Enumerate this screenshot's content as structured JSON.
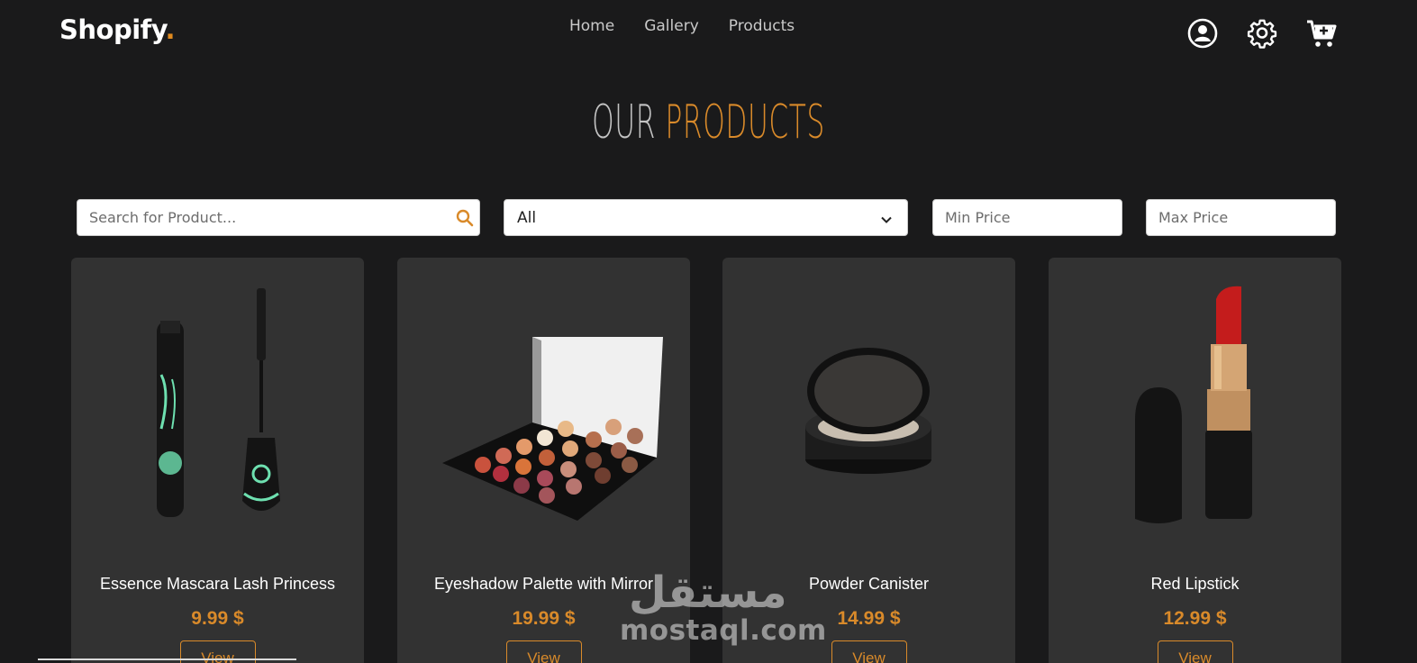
{
  "navbar": {
    "brand": "Shopify",
    "brand_dot": ".",
    "links": [
      "Home",
      "Gallery",
      "Products"
    ],
    "icons": [
      "user-icon",
      "gear-icon",
      "cart-plus-icon"
    ]
  },
  "heading": {
    "part1": "OUR",
    "part2": "PRODUCTS"
  },
  "filters": {
    "search_placeholder": "Search for Product...",
    "category_value": "All",
    "min_price_placeholder": "Min Price",
    "max_price_placeholder": "Max Price"
  },
  "products": [
    {
      "name": "Essence Mascara Lash Princess",
      "price": "9.99 $",
      "button": "View"
    },
    {
      "name": "Eyeshadow Palette with Mirror",
      "price": "19.99 $",
      "button": "View"
    },
    {
      "name": "Powder Canister",
      "price": "14.99 $",
      "button": "View"
    },
    {
      "name": "Red Lipstick",
      "price": "12.99 $",
      "button": "View"
    }
  ],
  "watermark": {
    "arabic": "مستقل",
    "latin": "mostaql.com"
  },
  "colors": {
    "accent": "#d98a2a",
    "background": "#1a1a1b",
    "card": "#323232"
  }
}
